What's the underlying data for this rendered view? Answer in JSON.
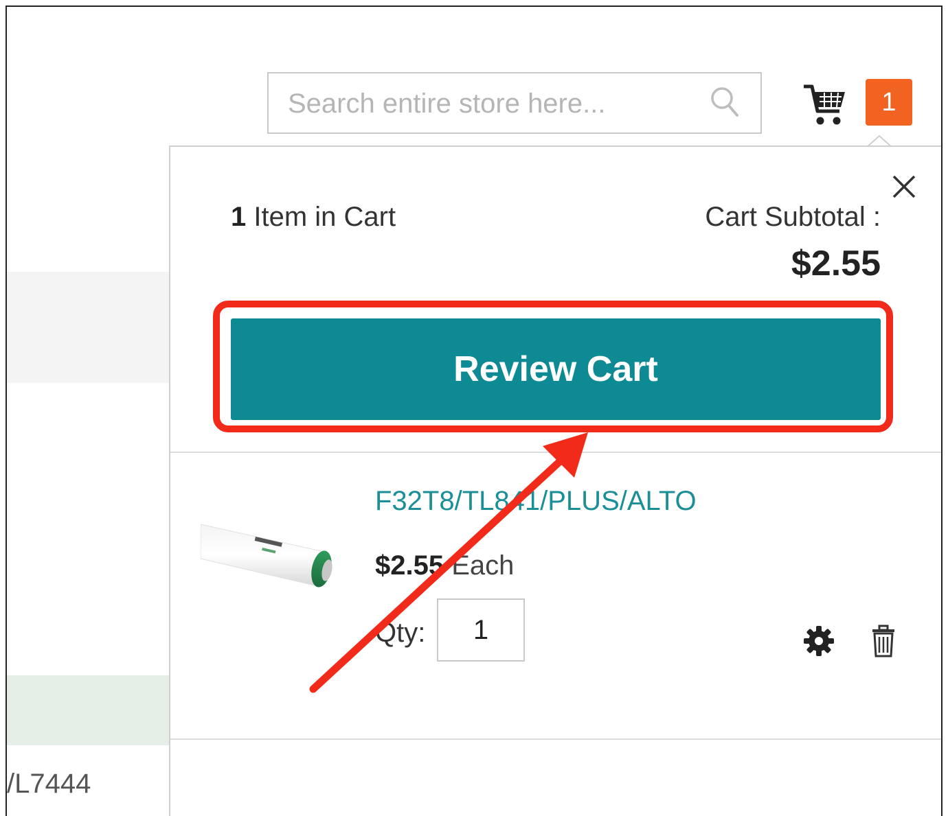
{
  "search": {
    "placeholder": "Search entire store here..."
  },
  "cart": {
    "badge_count": "1"
  },
  "background": {
    "sku_fragment": "/L7444"
  },
  "minicart": {
    "items_count": "1",
    "items_label": " Item in Cart",
    "subtotal_label": "Cart Subtotal :",
    "subtotal_value": "$2.55",
    "review_button": "Review Cart",
    "item": {
      "name": "F32T8/TL841/PLUS/ALTO",
      "price": "$2.55",
      "price_unit": " Each",
      "qty_label": "Qty:",
      "qty_value": "1"
    }
  },
  "colors": {
    "accent": "#0d8a93",
    "badge": "#f26322",
    "annotation": "#f22a1a"
  },
  "icons": [
    "search-icon",
    "cart-icon",
    "close-icon",
    "gear-icon",
    "trash-icon"
  ]
}
